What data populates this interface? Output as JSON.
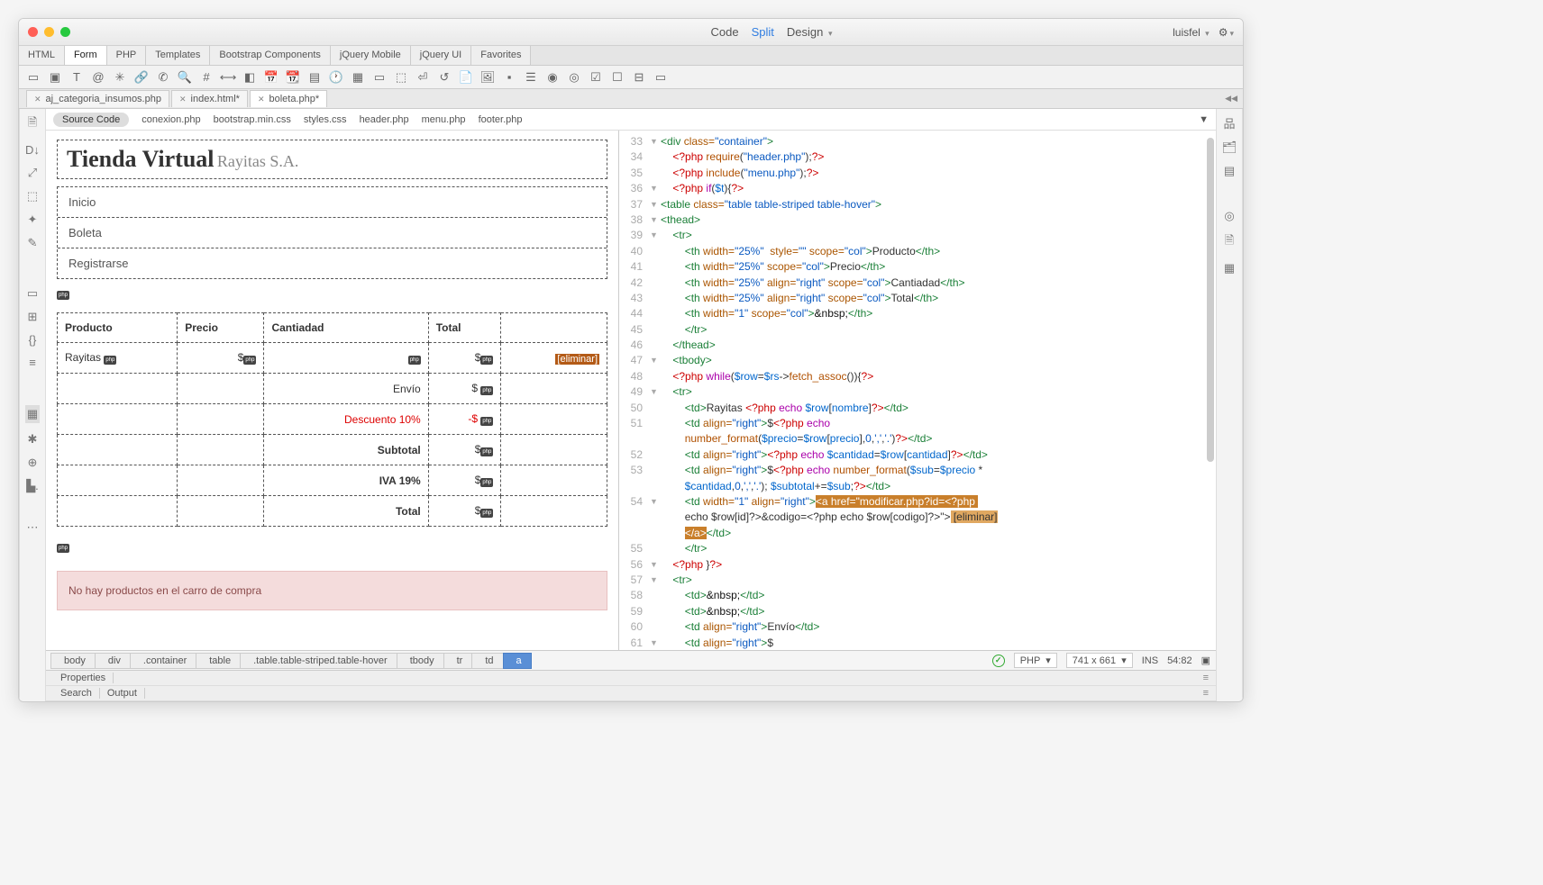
{
  "title": {
    "user": "luisfel"
  },
  "viewmodes": {
    "code": "Code",
    "split": "Split",
    "design": "Design"
  },
  "menutabs": [
    "HTML",
    "Form",
    "PHP",
    "Templates",
    "Bootstrap Components",
    "jQuery Mobile",
    "jQuery UI",
    "Favorites"
  ],
  "filetabs": [
    {
      "label": "aj_categoria_insumos.php",
      "active": false
    },
    {
      "label": "index.html*",
      "active": false
    },
    {
      "label": "boleta.php*",
      "active": true
    }
  ],
  "related": {
    "source": "Source Code",
    "files": [
      "conexion.php",
      "bootstrap.min.css",
      "styles.css",
      "header.php",
      "menu.php",
      "footer.php"
    ]
  },
  "preview": {
    "heading": "Tienda Virtual",
    "subheading": "Rayitas S.A.",
    "nav": [
      "Inicio",
      "Boleta",
      "Registrarse"
    ],
    "table": {
      "headers": [
        "Producto",
        "Precio",
        "Cantiadad",
        "Total"
      ],
      "row1": {
        "producto": "Rayitas ",
        "precio": "$",
        "total": "$",
        "action": "[eliminar]"
      },
      "envio": {
        "label": "Envío",
        "val": "$ "
      },
      "desc": {
        "label": "Descuento 10%",
        "val": "-$ "
      },
      "subtotal": {
        "label": "Subtotal",
        "val": "$"
      },
      "iva": {
        "label": "IVA 19%",
        "val": "$"
      },
      "total": {
        "label": "Total",
        "val": "$"
      }
    },
    "alert": "No hay productos en el carro de compra"
  },
  "code_lines": [
    {
      "n": 33,
      "arr": "▼",
      "html": "<span class='c-tag'>&lt;div</span> <span class='c-attr'>class=</span><span class='c-str'>\"container\"</span><span class='c-tag'>&gt;</span>"
    },
    {
      "n": 34,
      "arr": "",
      "html": "    <span class='c-php'>&lt;?php</span> <span class='c-fn'>require</span>(<span class='c-str'>\"header.php\"</span>);<span class='c-php'>?&gt;</span>"
    },
    {
      "n": 35,
      "arr": "",
      "html": "    <span class='c-php'>&lt;?php</span> <span class='c-fn'>include</span>(<span class='c-str'>\"menu.php\"</span>);<span class='c-php'>?&gt;</span>"
    },
    {
      "n": 36,
      "arr": "▼",
      "html": "    <span class='c-php'>&lt;?php</span> <span class='c-kw'>if</span>(<span class='c-var'>$t</span>){<span class='c-php'>?&gt;</span>"
    },
    {
      "n": 37,
      "arr": "▼",
      "html": "<span class='c-tag'>&lt;table</span> <span class='c-attr'>class=</span><span class='c-str'>\"table table-striped table-hover\"</span><span class='c-tag'>&gt;</span>"
    },
    {
      "n": 38,
      "arr": "▼",
      "html": "<span class='c-tag'>&lt;thead&gt;</span>"
    },
    {
      "n": 39,
      "arr": "▼",
      "html": "    <span class='c-tag'>&lt;tr&gt;</span>"
    },
    {
      "n": 40,
      "arr": "",
      "html": "        <span class='c-tag'>&lt;th</span> <span class='c-attr'>width=</span><span class='c-str'>\"25%\"</span>  <span class='c-attr'>style=</span><span class='c-str'>\"\"</span> <span class='c-attr'>scope=</span><span class='c-str'>\"col\"</span><span class='c-tag'>&gt;</span>Producto<span class='c-tag'>&lt;/th&gt;</span>"
    },
    {
      "n": 41,
      "arr": "",
      "html": "        <span class='c-tag'>&lt;th</span> <span class='c-attr'>width=</span><span class='c-str'>\"25%\"</span> <span class='c-attr'>scope=</span><span class='c-str'>\"col\"</span><span class='c-tag'>&gt;</span>Precio<span class='c-tag'>&lt;/th&gt;</span>"
    },
    {
      "n": 42,
      "arr": "",
      "html": "        <span class='c-tag'>&lt;th</span> <span class='c-attr'>width=</span><span class='c-str'>\"25%\"</span> <span class='c-attr'>align=</span><span class='c-str'>\"right\"</span> <span class='c-attr'>scope=</span><span class='c-str'>\"col\"</span><span class='c-tag'>&gt;</span>Cantiadad<span class='c-tag'>&lt;/th&gt;</span>"
    },
    {
      "n": 43,
      "arr": "",
      "html": "        <span class='c-tag'>&lt;th</span> <span class='c-attr'>width=</span><span class='c-str'>\"25%\"</span> <span class='c-attr'>align=</span><span class='c-str'>\"right\"</span> <span class='c-attr'>scope=</span><span class='c-str'>\"col\"</span><span class='c-tag'>&gt;</span>Total<span class='c-tag'>&lt;/th&gt;</span>"
    },
    {
      "n": 44,
      "arr": "",
      "html": "        <span class='c-tag'>&lt;th</span> <span class='c-attr'>width=</span><span class='c-str'>\"1\"</span> <span class='c-attr'>scope=</span><span class='c-str'>\"col\"</span><span class='c-tag'>&gt;</span><span class='c-blk'>&amp;nbsp;</span><span class='c-tag'>&lt;/th&gt;</span>"
    },
    {
      "n": 45,
      "arr": "",
      "html": "        <span class='c-tag'>&lt;/tr&gt;</span>"
    },
    {
      "n": 46,
      "arr": "",
      "html": "    <span class='c-tag'>&lt;/thead&gt;</span>"
    },
    {
      "n": 47,
      "arr": "▼",
      "html": "    <span class='c-tag'>&lt;tbody&gt;</span>"
    },
    {
      "n": 48,
      "arr": "",
      "html": "    <span class='c-php'>&lt;?php</span> <span class='c-kw'>while</span>(<span class='c-var'>$row</span>=<span class='c-var'>$rs</span>-&gt;<span class='c-fn'>fetch_assoc</span>()){<span class='c-php'>?&gt;</span>"
    },
    {
      "n": 49,
      "arr": "▼",
      "html": "    <span class='c-tag'>&lt;tr&gt;</span>"
    },
    {
      "n": 50,
      "arr": "",
      "html": "        <span class='c-tag'>&lt;td&gt;</span>Rayitas <span class='c-php'>&lt;?php</span> <span class='c-kw'>echo</span> <span class='c-var'>$row</span>[<span class='c-var'>nombre</span>]<span class='c-php'>?&gt;</span><span class='c-tag'>&lt;/td&gt;</span>"
    },
    {
      "n": 51,
      "arr": "",
      "html": "        <span class='c-tag'>&lt;td</span> <span class='c-attr'>align=</span><span class='c-str'>\"right\"</span><span class='c-tag'>&gt;</span>$<span class='c-php'>&lt;?php</span> <span class='c-kw'>echo</span> \n        <span class='c-fn'>number_format</span>(<span class='c-var'>$precio</span>=<span class='c-var'>$row</span>[<span class='c-var'>precio</span>],<span class='c-str'>0</span>,<span class='c-str'>','</span>,<span class='c-str'>'.'</span>)<span class='c-php'>?&gt;</span><span class='c-tag'>&lt;/td&gt;</span>"
    },
    {
      "n": 52,
      "arr": "",
      "html": "        <span class='c-tag'>&lt;td</span> <span class='c-attr'>align=</span><span class='c-str'>\"right\"</span><span class='c-tag'>&gt;</span><span class='c-php'>&lt;?php</span> <span class='c-kw'>echo</span> <span class='c-var'>$cantidad</span>=<span class='c-var'>$row</span>[<span class='c-var'>cantidad</span>]<span class='c-php'>?&gt;</span><span class='c-tag'>&lt;/td&gt;</span>"
    },
    {
      "n": 53,
      "arr": "",
      "html": "        <span class='c-tag'>&lt;td</span> <span class='c-attr'>align=</span><span class='c-str'>\"right\"</span><span class='c-tag'>&gt;</span>$<span class='c-php'>&lt;?php</span> <span class='c-kw'>echo</span> <span class='c-fn'>number_format</span>(<span class='c-var'>$sub</span>=<span class='c-var'>$precio</span> * \n        <span class='c-var'>$cantidad</span>,<span class='c-str'>0</span>,<span class='c-str'>','</span>,<span class='c-str'>'.'</span>); <span class='c-var'>$subtotal</span>+=<span class='c-var'>$sub</span>;<span class='c-php'>?&gt;</span><span class='c-tag'>&lt;/td&gt;</span>"
    },
    {
      "n": 54,
      "arr": "▼",
      "html": "        <span class='c-tag'>&lt;td</span> <span class='c-attr'>width=</span><span class='c-str'>\"1\"</span> <span class='c-attr'>align=</span><span class='c-str'>\"right\"</span><span class='c-tag'>&gt;</span><span class='hl'>&lt;a href=\"modificar.php?id=&lt;?php \n        echo $row[id]?&gt;&amp;codigo=&lt;?php echo $row[codigo]?&gt;\"&gt;</span><span class='hl2'> [eliminar]\n        </span><span class='hl'>&lt;/a&gt;</span><span class='c-tag'>&lt;/td&gt;</span>"
    },
    {
      "n": 55,
      "arr": "",
      "html": "        <span class='c-tag'>&lt;/tr&gt;</span>"
    },
    {
      "n": 56,
      "arr": "▼",
      "html": "    <span class='c-php'>&lt;?php</span> }<span class='c-php'>?&gt;</span>"
    },
    {
      "n": 57,
      "arr": "▼",
      "html": "    <span class='c-tag'>&lt;tr&gt;</span>"
    },
    {
      "n": 58,
      "arr": "",
      "html": "        <span class='c-tag'>&lt;td&gt;</span><span class='c-blk'>&amp;nbsp;</span><span class='c-tag'>&lt;/td&gt;</span>"
    },
    {
      "n": 59,
      "arr": "",
      "html": "        <span class='c-tag'>&lt;td&gt;</span><span class='c-blk'>&amp;nbsp;</span><span class='c-tag'>&lt;/td&gt;</span>"
    },
    {
      "n": 60,
      "arr": "",
      "html": "        <span class='c-tag'>&lt;td</span> <span class='c-attr'>align=</span><span class='c-str'>\"right\"</span><span class='c-tag'>&gt;</span>Envío<span class='c-tag'>&lt;/td&gt;</span>"
    },
    {
      "n": 61,
      "arr": "▼",
      "html": "        <span class='c-tag'>&lt;td</span> <span class='c-attr'>align=</span><span class='c-str'>\"right\"</span><span class='c-tag'>&gt;</span>$"
    }
  ],
  "breadcrumb": [
    "body",
    "div",
    ".container",
    "table",
    ".table.table-striped.table-hover",
    "tbody",
    "tr",
    "td",
    "a"
  ],
  "status": {
    "lang": "PHP",
    "dims": "741 x 661",
    "mode": "INS",
    "pos": "54:82"
  },
  "panels": {
    "properties": "Properties",
    "search": "Search",
    "output": "Output"
  }
}
